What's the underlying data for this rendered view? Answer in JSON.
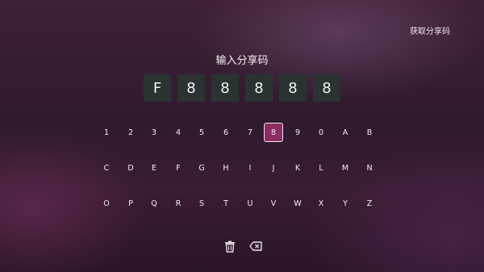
{
  "header": {
    "get_share_code_label": "获取分享码"
  },
  "title": "输入分享码",
  "code_digits": [
    "F",
    "8",
    "8",
    "8",
    "8",
    "8"
  ],
  "keyboard": {
    "rows": [
      [
        "1",
        "2",
        "3",
        "4",
        "5",
        "6",
        "7",
        "8",
        "9",
        "0",
        "A",
        "B"
      ],
      [
        "C",
        "D",
        "E",
        "F",
        "G",
        "H",
        "I",
        "J",
        "K",
        "L",
        "M",
        "N"
      ],
      [
        "O",
        "P",
        "Q",
        "R",
        "S",
        "T",
        "U",
        "V",
        "W",
        "X",
        "Y",
        "Z"
      ]
    ],
    "selected_key": "8"
  },
  "actions": {
    "clear_icon": "trash-icon",
    "backspace_icon": "backspace-icon"
  },
  "colors": {
    "selected_key_bg": "#8e2c64",
    "code_box_bg": "#2a3331"
  }
}
